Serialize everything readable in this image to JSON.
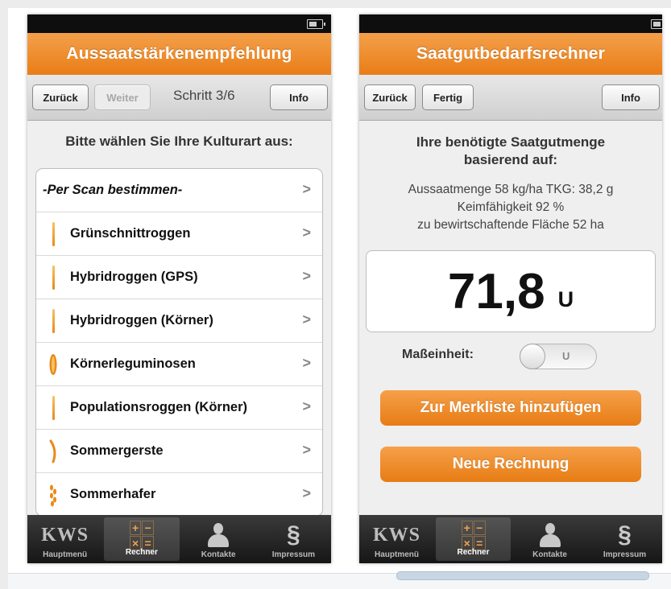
{
  "left": {
    "title": "Aussaatstärkenempfehlung",
    "toolbar": {
      "back": "Zurück",
      "next": "Weiter",
      "step": "Schritt 3/6",
      "info": "Info"
    },
    "prompt": "Bitte wählen Sie Ihre Kulturart aus:",
    "items": [
      {
        "label": "-Per Scan bestimmen-",
        "icon": "none"
      },
      {
        "label": "Grünschnittroggen",
        "icon": "rye-icon"
      },
      {
        "label": "Hybridroggen (GPS)",
        "icon": "rye-icon"
      },
      {
        "label": "Hybridroggen (Körner)",
        "icon": "rye-icon"
      },
      {
        "label": "Körnerleguminosen",
        "icon": "legume-icon"
      },
      {
        "label": "Populationsroggen (Körner)",
        "icon": "rye-icon"
      },
      {
        "label": "Sommergerste",
        "icon": "barley-icon"
      },
      {
        "label": "Sommerhafer",
        "icon": "oat-icon"
      }
    ]
  },
  "right": {
    "title": "Saatgutbedarfsrechner",
    "toolbar": {
      "back": "Zurück",
      "done": "Fertig",
      "info": "Info"
    },
    "headline_1": "Ihre benötigte Saatgutmenge",
    "headline_2": "basierend auf:",
    "info_1": "Aussaatmenge 58 kg/ha TKG: 38,2 g",
    "info_2": "Keimfähigkeit 92 %",
    "info_3": "zu bewirtschaftende Fläche 52 ha",
    "result_value": "71,8",
    "result_unit": "U",
    "unit_label": "Maßeinheit:",
    "unit_toggle": "U",
    "add_button": "Zur Merkliste hinzufügen",
    "new_button": "Neue Rechnung"
  },
  "tabs": [
    {
      "label": "Hauptmenü",
      "icon": "kws-logo",
      "logo_text": "KWS"
    },
    {
      "label": "Rechner",
      "icon": "calculator-icon",
      "glyphs": [
        "+",
        "−",
        "×",
        "="
      ]
    },
    {
      "label": "Kontakte",
      "icon": "person-icon"
    },
    {
      "label": "Impressum",
      "icon": "paragraph-icon",
      "glyph": "§"
    }
  ],
  "colors": {
    "accent": "#e97d17",
    "tabbar": "#1e1e1e"
  }
}
